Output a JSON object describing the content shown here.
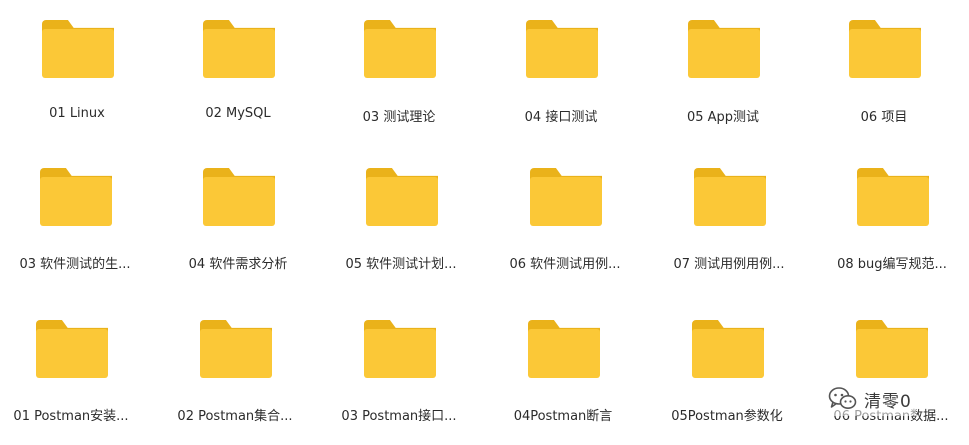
{
  "colors": {
    "folder_front": "#fbc837",
    "folder_back": "#eab21a",
    "label_text": "#2b2b2b"
  },
  "folders": [
    {
      "label": "01 Linux",
      "icon": "folder-icon"
    },
    {
      "label": "02 MySQL",
      "icon": "folder-icon"
    },
    {
      "label": "03 测试理论",
      "icon": "folder-icon"
    },
    {
      "label": "04 接口测试",
      "icon": "folder-icon"
    },
    {
      "label": "05 App测试",
      "icon": "folder-icon"
    },
    {
      "label": "06 项目",
      "icon": "folder-icon"
    },
    {
      "label": "03 软件测试的生...",
      "icon": "folder-icon"
    },
    {
      "label": "04 软件需求分析",
      "icon": "folder-icon"
    },
    {
      "label": "05 软件测试计划...",
      "icon": "folder-icon"
    },
    {
      "label": "06 软件测试用例...",
      "icon": "folder-icon"
    },
    {
      "label": "07 测试用例用例...",
      "icon": "folder-icon"
    },
    {
      "label": "08 bug编写规范...",
      "icon": "folder-icon"
    },
    {
      "label": "01 Postman安装...",
      "icon": "folder-icon"
    },
    {
      "label": "02 Postman集合...",
      "icon": "folder-icon"
    },
    {
      "label": "03 Postman接口...",
      "icon": "folder-icon"
    },
    {
      "label": "04Postman断言",
      "icon": "folder-icon"
    },
    {
      "label": "05Postman参数化",
      "icon": "folder-icon"
    },
    {
      "label": "06 Postman数据...",
      "icon": "folder-icon"
    }
  ],
  "watermark": {
    "icon": "wechat-icon",
    "text": "清零0"
  }
}
